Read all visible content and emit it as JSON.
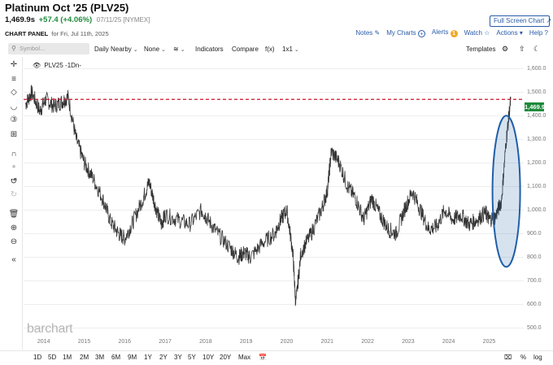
{
  "header": {
    "title": "Platinum Oct '25 (PLV25)",
    "last": "1,469.9s",
    "change": "+57.4 (+4.06%)",
    "meta": "07/11/25 [NYMEX]",
    "fullscreen_label": "Full Screen Chart",
    "fullscreen_icon": "external-link-icon"
  },
  "panel": {
    "label": "CHART PANEL",
    "date": "for Fri, Jul 11th, 2025"
  },
  "actions": {
    "notes": "Notes",
    "my_charts": "My Charts",
    "alerts": "Alerts",
    "alerts_count": "1",
    "watch": "Watch",
    "actions": "Actions",
    "help": "Help"
  },
  "toolbar": {
    "symbol_placeholder": "Symbol...",
    "period": "Daily Nearby",
    "compare_mode": "None",
    "indicators": "Indicators",
    "compare": "Compare",
    "fx": "f(x)",
    "layout": "1x1",
    "templates": "Templates"
  },
  "chart": {
    "legend": "PLV25 -1Dn-",
    "last_price_tag": "1,469.9",
    "reference_line_value": 1469.9,
    "brand": "barchart",
    "line_color": "#333333",
    "reference_line_color": "#d0102b",
    "highlight_color": "#1f5fa8",
    "price_tag_color": "#1f8a3b"
  },
  "chart_data": {
    "type": "line",
    "title": "",
    "ylim": [
      450,
      1650
    ],
    "yticks": [
      "1,600.0",
      "1,500.0",
      "1,400.0",
      "1,300.0",
      "1,200.0",
      "1,100.0",
      "1,000.0",
      "900.0",
      "800.0",
      "700.0",
      "600.0",
      "500.0"
    ],
    "ytick_values": [
      1600,
      1500,
      1400,
      1300,
      1200,
      1100,
      1000,
      900,
      800,
      700,
      600,
      500
    ],
    "xticks": [
      "2014",
      "2015",
      "2016",
      "2017",
      "2018",
      "2019",
      "2020",
      "2021",
      "2022",
      "2023",
      "2024",
      "2025"
    ],
    "xlim": [
      2013.5,
      2025.85
    ],
    "series": [
      {
        "x": [
          2013.55,
          2013.7,
          2013.9,
          2014.05,
          2014.25,
          2014.45,
          2014.6,
          2014.8,
          2015.0,
          2015.2,
          2015.45,
          2015.65,
          2015.85,
          2016.0,
          2016.2,
          2016.45,
          2016.6,
          2016.75,
          2016.9,
          2017.0,
          2017.3,
          2017.6,
          2017.9,
          2018.05,
          2018.3,
          2018.6,
          2018.8,
          2018.95,
          2019.1,
          2019.4,
          2019.7,
          2019.85,
          2020.0,
          2020.15,
          2020.22,
          2020.35,
          2020.6,
          2020.85,
          2021.0,
          2021.1,
          2021.3,
          2021.5,
          2021.7,
          2021.9,
          2022.1,
          2022.3,
          2022.5,
          2022.7,
          2022.9,
          2023.1,
          2023.3,
          2023.5,
          2023.7,
          2023.9,
          2024.1,
          2024.3,
          2024.5,
          2024.7,
          2024.9,
          2025.0,
          2025.15,
          2025.3,
          2025.42,
          2025.53
        ],
        "y": [
          1450,
          1500,
          1420,
          1470,
          1440,
          1460,
          1480,
          1300,
          1200,
          1140,
          1050,
          950,
          900,
          880,
          950,
          1050,
          1120,
          1020,
          940,
          980,
          960,
          940,
          1000,
          960,
          900,
          840,
          800,
          820,
          800,
          860,
          900,
          960,
          1000,
          820,
          600,
          820,
          900,
          1000,
          1080,
          1250,
          1200,
          1100,
          1050,
          960,
          1050,
          980,
          920,
          900,
          1000,
          1080,
          1000,
          920,
          930,
          1000,
          960,
          980,
          940,
          960,
          990,
          960,
          970,
          1040,
          1300,
          1469.9
        ]
      }
    ]
  },
  "range_buttons": [
    "1D",
    "5D",
    "1M",
    "2M",
    "3M",
    "6M",
    "9M",
    "1Y",
    "2Y",
    "3Y",
    "5Y",
    "10Y",
    "20Y",
    "Max"
  ],
  "bottom_right": {
    "percent": "%",
    "log": "log"
  }
}
